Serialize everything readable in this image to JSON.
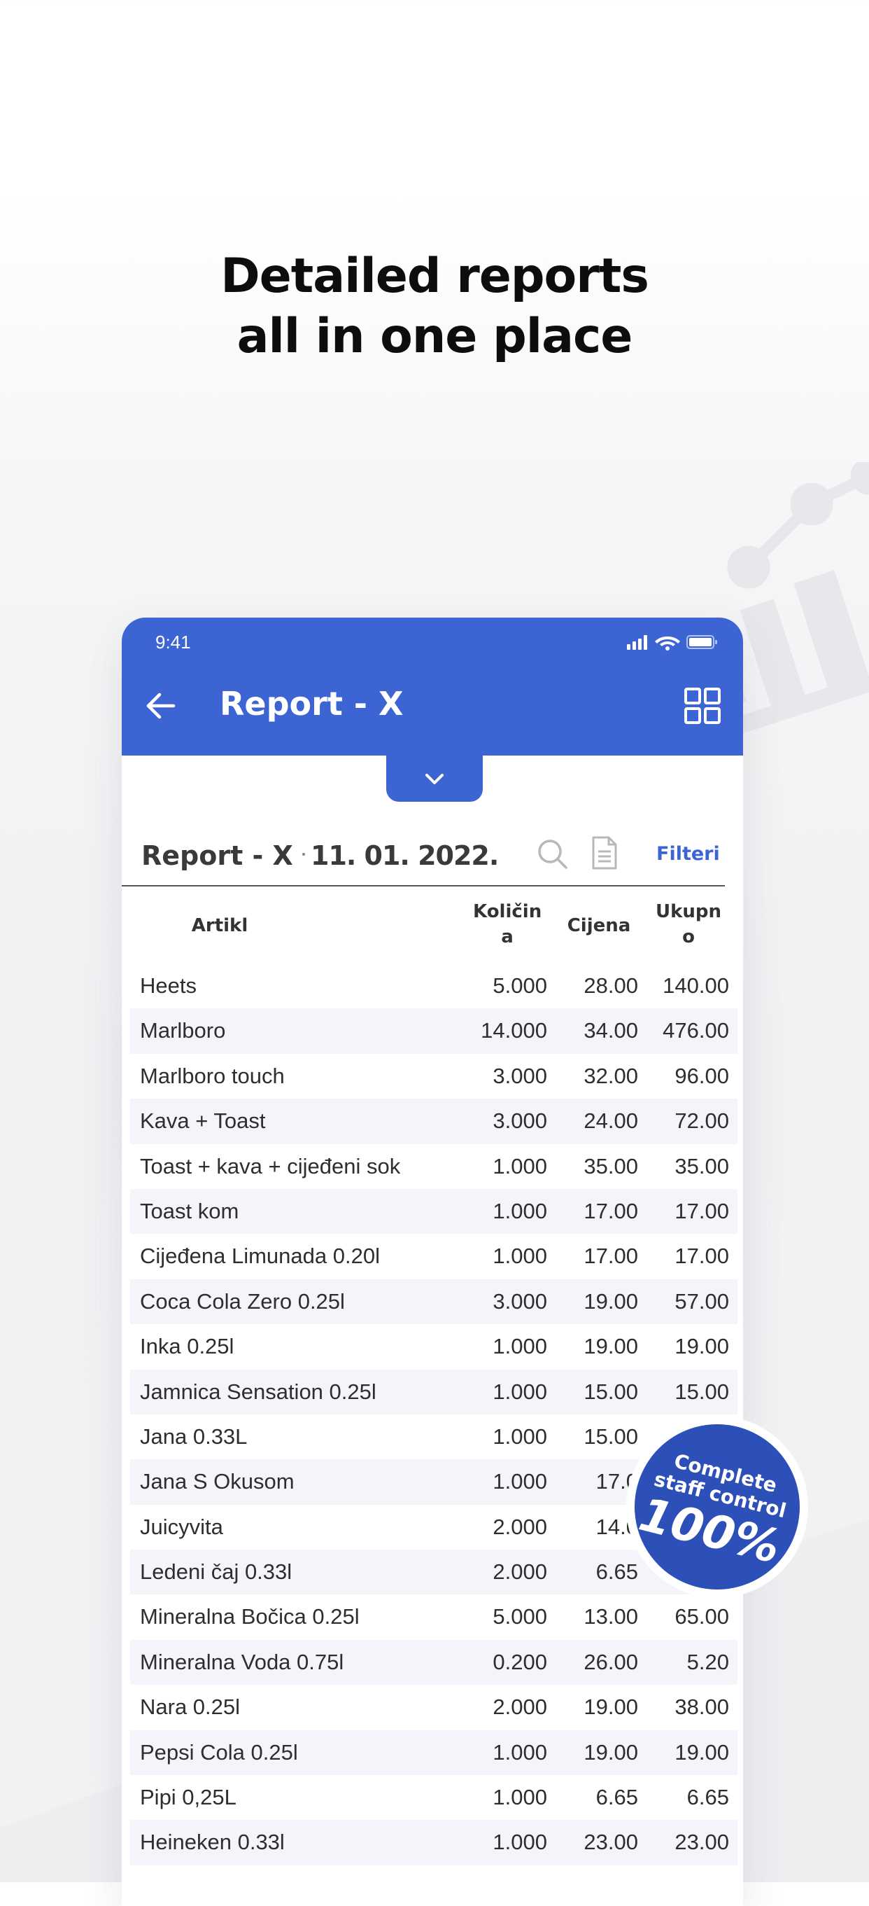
{
  "headline": {
    "line1": "Detailed reports",
    "line2": "all in one place"
  },
  "status_bar": {
    "time": "9:41"
  },
  "app_bar": {
    "title": "Report - X"
  },
  "toolbar": {
    "title": "Report - X",
    "date": "11. 01. 2022.",
    "filter_label": "Filteri"
  },
  "table": {
    "headers": {
      "artikl": "Artikl",
      "kolicina_1": "Količin",
      "kolicina_2": "a",
      "cijena": "Cijena",
      "ukupno_1": "Ukupn",
      "ukupno_2": "o"
    },
    "rows": [
      {
        "name": "Heets",
        "qty": "5.000",
        "price": "28.00",
        "total": "140.00"
      },
      {
        "name": "Marlboro",
        "qty": "14.000",
        "price": "34.00",
        "total": "476.00"
      },
      {
        "name": "Marlboro touch",
        "qty": "3.000",
        "price": "32.00",
        "total": "96.00"
      },
      {
        "name": "Kava + Toast",
        "qty": "3.000",
        "price": "24.00",
        "total": "72.00"
      },
      {
        "name": "Toast + kava + cijeđeni sok",
        "qty": "1.000",
        "price": "35.00",
        "total": "35.00"
      },
      {
        "name": "Toast kom",
        "qty": "1.000",
        "price": "17.00",
        "total": "17.00"
      },
      {
        "name": "Cijeđena Limunada 0.20l",
        "qty": "1.000",
        "price": "17.00",
        "total": "17.00"
      },
      {
        "name": "Coca Cola Zero 0.25l",
        "qty": "3.000",
        "price": "19.00",
        "total": "57.00"
      },
      {
        "name": "Inka 0.25l",
        "qty": "1.000",
        "price": "19.00",
        "total": "19.00"
      },
      {
        "name": "Jamnica Sensation 0.25l",
        "qty": "1.000",
        "price": "15.00",
        "total": "15.00"
      },
      {
        "name": "Jana 0.33L",
        "qty": "1.000",
        "price": "15.00",
        "total": ""
      },
      {
        "name": "Jana S Okusom",
        "qty": "1.000",
        "price": "17.0",
        "total": ""
      },
      {
        "name": "Juicyvita",
        "qty": "2.000",
        "price": "14.0",
        "total": ""
      },
      {
        "name": "Ledeni čaj 0.33l",
        "qty": "2.000",
        "price": "6.65",
        "total": ""
      },
      {
        "name": "Mineralna Bočica 0.25l",
        "qty": "5.000",
        "price": "13.00",
        "total": "65.00"
      },
      {
        "name": "Mineralna Voda  0.75l",
        "qty": "0.200",
        "price": "26.00",
        "total": "5.20"
      },
      {
        "name": "Nara 0.25l",
        "qty": "2.000",
        "price": "19.00",
        "total": "38.00"
      },
      {
        "name": "Pepsi Cola  0.25l",
        "qty": "1.000",
        "price": "19.00",
        "total": "19.00"
      },
      {
        "name": "Pipi 0,25L",
        "qty": "1.000",
        "price": "6.65",
        "total": "6.65"
      },
      {
        "name": "Heineken 0.33l",
        "qty": "1.000",
        "price": "23.00",
        "total": "23.00"
      }
    ]
  },
  "badge": {
    "line1": "Complete",
    "line2": "staff control",
    "percent": "100%"
  },
  "colors": {
    "accent": "#3c64d3",
    "badge": "#2d4fb8",
    "row_alt": "#f4f5fa"
  },
  "icons": [
    "back-arrow-icon",
    "grid-icon",
    "chevron-down-icon",
    "search-icon",
    "document-icon",
    "signal-icon",
    "wifi-icon",
    "battery-icon",
    "chart-decoration-icon"
  ]
}
